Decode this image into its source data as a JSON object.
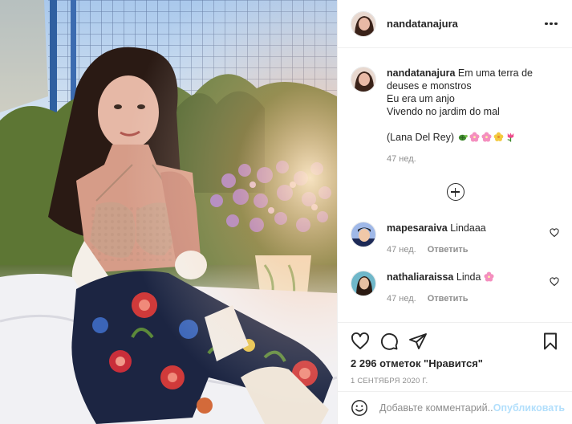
{
  "post": {
    "author": "nandatanajura",
    "more_icon": "ellipsis-icon"
  },
  "caption": {
    "user": "nandatanajura",
    "text": "Em uma terra de deuses e monstros\nEu era um anjo\nVivendo no jardim do mal\n\n(Lana Del Rey)",
    "emojis": [
      "turtle-emoji",
      "cherry-blossom-emoji",
      "cherry-blossom-emoji",
      "blossom-emoji",
      "tulip-emoji"
    ],
    "time": "47 нед."
  },
  "comments": [
    {
      "user": "mapesaraiva",
      "text": "Lindaaa",
      "time": "47 нед.",
      "reply_label": "Ответить"
    },
    {
      "user": "nathaliaraissa",
      "text": "Linda",
      "emoji": "cherry-blossom-emoji",
      "time": "47 нед.",
      "reply_label": "Ответить"
    }
  ],
  "actions": {
    "like_icon": "heart-icon",
    "comment_icon": "comment-icon",
    "share_icon": "paper-plane-icon",
    "save_icon": "bookmark-icon"
  },
  "likes": "2 296 отметок \"Нравится\"",
  "date": "1 СЕНТЯБРЯ 2020 Г.",
  "add_comment": {
    "placeholder": "Добавьте комментарий...",
    "publish_label": "Опубликовать"
  },
  "colors": {
    "text": "#262626",
    "secondary": "#8e8e8e",
    "publish_disabled": "#b2dffc",
    "border": "#efefef"
  }
}
